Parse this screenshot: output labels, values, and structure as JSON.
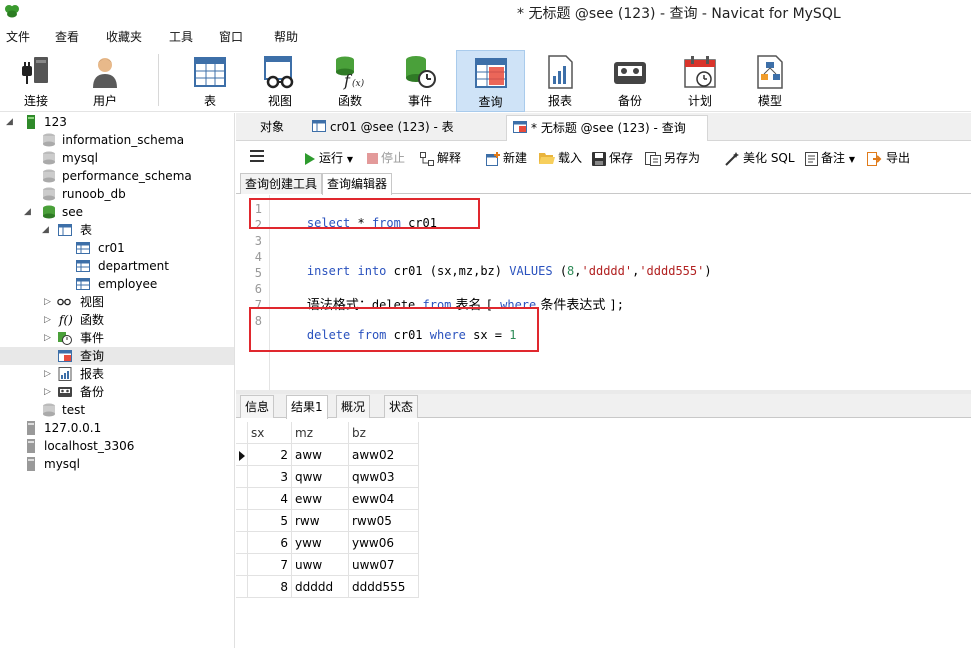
{
  "window": {
    "title": "* 无标题 @see (123) - 查询 - Navicat for MySQL"
  },
  "menu": [
    "文件",
    "查看",
    "收藏夹",
    "工具",
    "窗口",
    "帮助"
  ],
  "ribbon": {
    "connect": "连接",
    "user": "用户",
    "table": "表",
    "view": "视图",
    "function": "函数",
    "event": "事件",
    "query": "查询",
    "report": "报表",
    "backup": "备份",
    "schedule": "计划",
    "model": "模型"
  },
  "tree": {
    "conn_123": "123",
    "information_schema": "information_schema",
    "mysql_db": "mysql",
    "performance_schema": "performance_schema",
    "runoob_db": "runoob_db",
    "see": "see",
    "tables": "表",
    "cr01": "cr01",
    "department": "department",
    "employee": "employee",
    "views": "视图",
    "functions": "函数",
    "events": "事件",
    "queries": "查询",
    "reports": "报表",
    "backups": "备份",
    "test": "test",
    "conn_local_ip": "127.0.0.1",
    "conn_localhost": "localhost_3306",
    "conn_mysql": "mysql"
  },
  "tabs": {
    "objects": "对象",
    "cr01_table": "cr01 @see (123) - 表",
    "query": "* 无标题 @see (123) - 查询"
  },
  "qtoolbar": {
    "run": "运行",
    "stop": "停止",
    "explain": "解释",
    "new": "新建",
    "load": "载入",
    "save": "保存",
    "save_as": "另存为",
    "beautify": "美化 SQL",
    "note": "备注",
    "export": "导出"
  },
  "subtabs": {
    "builder": "查询创建工具",
    "editor": "查询编辑器"
  },
  "editor": {
    "line_numbers": [
      "1",
      "2",
      "3",
      "4",
      "5",
      "6",
      "7",
      "8"
    ],
    "l1": {
      "kw1": "select",
      "t1": " * ",
      "kw2": "from",
      "t2": " cr01"
    },
    "l4": {
      "kw1": "insert",
      "t1": " ",
      "kw2": "into",
      "t2": " cr01 (sx,mz,bz) ",
      "kw3": "VALUES",
      "t3": " (",
      "n1": "8",
      "t4": ",",
      "s1": "'ddddd'",
      "t5": ",",
      "s2": "'dddd555'",
      "t6": ")"
    },
    "l6": {
      "cn1": "语法格式：",
      "t1": "delete ",
      "kw1": "from",
      "cn2": " 表名 ",
      "t2": "[ ",
      "kw2": "where",
      "cn3": " 条件表达式 ",
      "t3": "];"
    },
    "l8": {
      "kw1": "delete",
      "t1": " ",
      "kw2": "from",
      "t2": " cr01 ",
      "kw3": "where",
      "t3": " sx = ",
      "n1": "1"
    }
  },
  "result_tabs": {
    "info": "信息",
    "result1": "结果1",
    "overview": "概况",
    "status": "状态"
  },
  "grid": {
    "columns": [
      "sx",
      "mz",
      "bz"
    ],
    "rows": [
      [
        "2",
        "aww",
        "aww02"
      ],
      [
        "3",
        "qww",
        "qww03"
      ],
      [
        "4",
        "eww",
        "eww04"
      ],
      [
        "5",
        "rww",
        "rww05"
      ],
      [
        "6",
        "yww",
        "yww06"
      ],
      [
        "7",
        "uww",
        "uww07"
      ],
      [
        "8",
        "ddddd",
        "dddd555"
      ]
    ]
  },
  "colors": {
    "accent": "#cfe3f7",
    "keyword": "#2a52be",
    "string": "#b22222",
    "number": "#2e8b57",
    "highlight": "#e0282e"
  }
}
